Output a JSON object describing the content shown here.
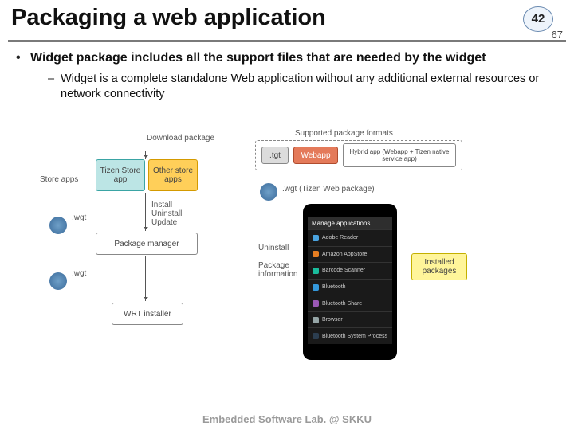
{
  "page": {
    "current": "42",
    "total": "67"
  },
  "title": "Packaging a web application",
  "bullet1": "Widget package includes all the support files that are needed by the widget",
  "sub1": "Widget is a complete standalone Web application without any additional external resources or network connectivity",
  "diagram": {
    "store_label": "Store apps",
    "tizen_store": "Tizen Store app",
    "other_store": "Other store apps",
    "download": "Download package",
    "install": "Install\nUninstall\nUpdate",
    "pkg_mgr": "Package manager",
    "wrt": "WRT installer",
    "supported_label": "Supported package formats",
    "tgt": ".tgt",
    "webapp": "Webapp",
    "hybrid": "Hybrid app (Webapp + Tizen native service app)",
    "wgt": ".wgt (Tizen Web package)",
    "uninstall": "Uninstall",
    "pkginfo": "Package\ninformation",
    "installed": "Installed\npackages",
    "phone_hdr": "Manage applications",
    "rows": [
      "Adobe Reader",
      "Amazon AppStore",
      "Barcode Scanner",
      "Bluetooth",
      "Bluetooth Share",
      "Browser",
      "Bluetooth System Process"
    ]
  },
  "footer": "Embedded Software Lab. @ SKKU",
  "colors": {
    "r1": "#4aa3df",
    "r2": "#e67e22",
    "r3": "#1abc9c",
    "r4": "#3498db",
    "r5": "#9b59b6",
    "r6": "#95a5a6",
    "r7": "#2c3e50"
  }
}
